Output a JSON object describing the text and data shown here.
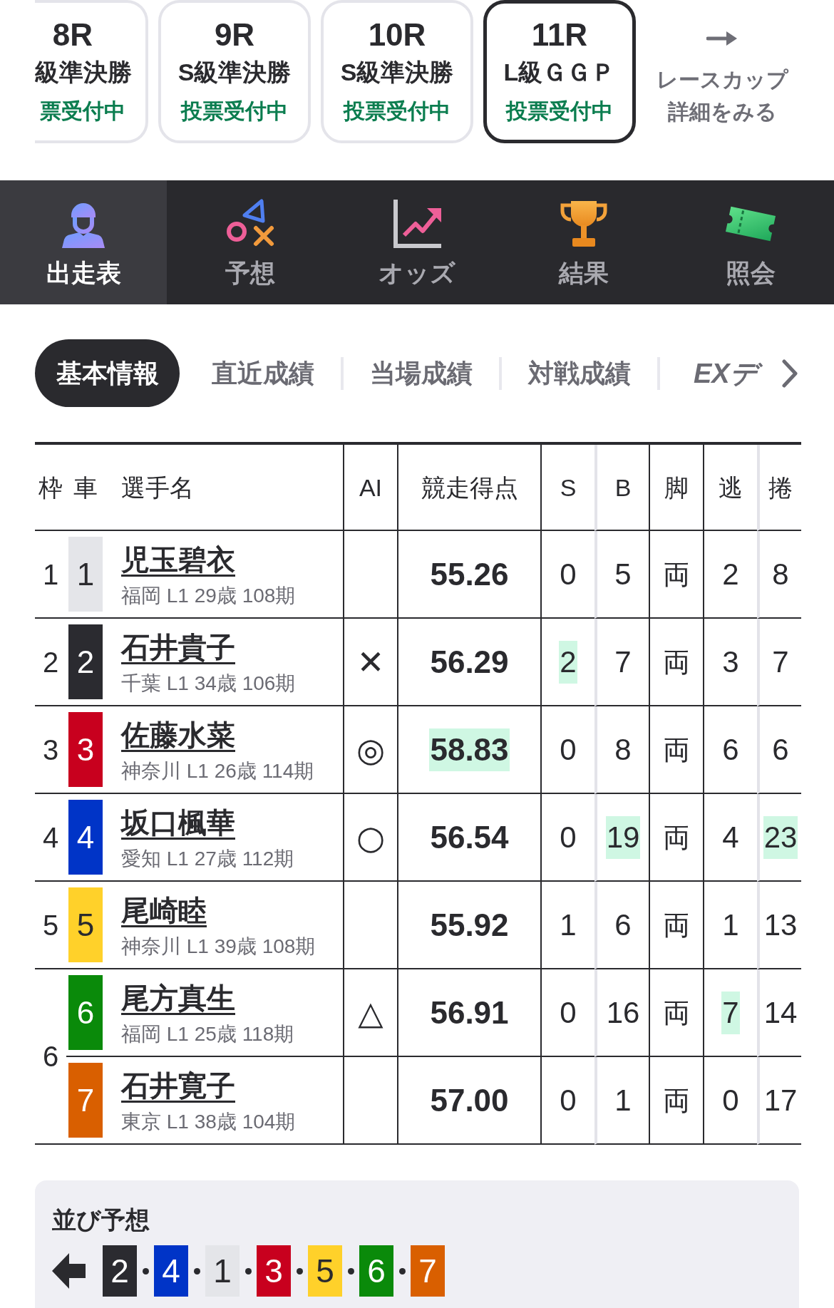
{
  "race_cards": [
    {
      "race": "8R",
      "grade": "級準決勝",
      "status": "票受付中",
      "selected": false,
      "cut_off": true
    },
    {
      "race": "9R",
      "grade": "S級準決勝",
      "status": "投票受付中",
      "selected": false
    },
    {
      "race": "10R",
      "grade": "S級準決勝",
      "status": "投票受付中",
      "selected": false
    },
    {
      "race": "11R",
      "grade": "L級ＧＧＰ",
      "status": "投票受付中",
      "selected": true
    }
  ],
  "cup_link": {
    "lines": [
      "レースカップ",
      "詳細をみる"
    ]
  },
  "nav_tabs": [
    {
      "label": "出走表",
      "kind": "entries",
      "selected": true
    },
    {
      "label": "予想",
      "kind": "prediction",
      "selected": false
    },
    {
      "label": "オッズ",
      "kind": "odds",
      "selected": false
    },
    {
      "label": "結果",
      "kind": "results",
      "selected": false
    },
    {
      "label": "照会",
      "kind": "inquiry",
      "selected": false
    }
  ],
  "sub_tabs": [
    {
      "label": "基本情報",
      "kind": "text",
      "selected": true
    },
    {
      "label": "直近成績",
      "kind": "text",
      "selected": false
    },
    {
      "label": "当場成績",
      "kind": "text",
      "selected": false
    },
    {
      "label": "対戦成績",
      "kind": "text",
      "selected": false
    },
    {
      "label": "EXデ",
      "kind": "logo",
      "selected": false
    }
  ],
  "table": {
    "columns": [
      "枠",
      "車",
      "選手名",
      "AI",
      "競走得点",
      "S",
      "B",
      "脚",
      "逃",
      "捲"
    ],
    "frames": [
      {
        "frame": "1",
        "entries": [
          {
            "car": "1",
            "color": "#e4e5e9",
            "name": "児玉碧衣",
            "profile": "福岡 L1 29歳 108期",
            "stats": [
              {
                "value": "55.26",
                "highlighted": false
              },
              {
                "value": "0",
                "highlighted": false
              },
              {
                "value": "5",
                "highlighted": false
              },
              {
                "value": "両",
                "highlighted": false
              },
              {
                "value": "2",
                "highlighted": false
              },
              {
                "value": "8",
                "highlighted": false
              }
            ]
          }
        ]
      },
      {
        "frame": "2",
        "entries": [
          {
            "car": "2",
            "color": "#2b2b30",
            "name": "石井貴子",
            "profile": "千葉 L1 34歳 106期",
            "ai_mark": "✕",
            "stats": [
              {
                "value": "56.29",
                "highlighted": false
              },
              {
                "value": "2",
                "highlighted": true
              },
              {
                "value": "7",
                "highlighted": false
              },
              {
                "value": "両",
                "highlighted": false
              },
              {
                "value": "3",
                "highlighted": false
              },
              {
                "value": "7",
                "highlighted": false
              }
            ]
          }
        ]
      },
      {
        "frame": "3",
        "entries": [
          {
            "car": "3",
            "color": "#c8001e",
            "name": "佐藤水菜",
            "profile": "神奈川 L1 26歳 114期",
            "ai_mark": "◎",
            "stats": [
              {
                "value": "58.83",
                "highlighted": true
              },
              {
                "value": "0",
                "highlighted": false
              },
              {
                "value": "8",
                "highlighted": false
              },
              {
                "value": "両",
                "highlighted": false
              },
              {
                "value": "6",
                "highlighted": false
              },
              {
                "value": "6",
                "highlighted": false
              }
            ]
          }
        ]
      },
      {
        "frame": "4",
        "entries": [
          {
            "car": "4",
            "color": "#0034c7",
            "name": "坂口楓華",
            "profile": "愛知 L1 27歳 112期",
            "ai_mark": "○",
            "stats": [
              {
                "value": "56.54",
                "highlighted": false
              },
              {
                "value": "0",
                "highlighted": false
              },
              {
                "value": "19",
                "highlighted": true
              },
              {
                "value": "両",
                "highlighted": false
              },
              {
                "value": "4",
                "highlighted": false
              },
              {
                "value": "23",
                "highlighted": true
              }
            ]
          }
        ]
      },
      {
        "frame": "5",
        "entries": [
          {
            "car": "5",
            "color": "#ffd12a",
            "name": "尾崎睦",
            "profile": "神奈川 L1 39歳 108期",
            "stats": [
              {
                "value": "55.92",
                "highlighted": false
              },
              {
                "value": "1",
                "highlighted": false
              },
              {
                "value": "6",
                "highlighted": false
              },
              {
                "value": "両",
                "highlighted": false
              },
              {
                "value": "1",
                "highlighted": false
              },
              {
                "value": "13",
                "highlighted": false
              }
            ]
          }
        ]
      },
      {
        "frame": "6",
        "entries": [
          {
            "car": "6",
            "color": "#0a8a0a",
            "name": "尾方真生",
            "profile": "福岡 L1 25歳 118期",
            "ai_mark": "△",
            "stats": [
              {
                "value": "56.91",
                "highlighted": false
              },
              {
                "value": "0",
                "highlighted": false
              },
              {
                "value": "16",
                "highlighted": false
              },
              {
                "value": "両",
                "highlighted": false
              },
              {
                "value": "7",
                "highlighted": true
              },
              {
                "value": "14",
                "highlighted": false
              }
            ]
          },
          {
            "car": "7",
            "color": "#d95f00",
            "name": "石井寛子",
            "profile": "東京 L1 38歳 104期",
            "stats": [
              {
                "value": "57.00",
                "highlighted": false
              },
              {
                "value": "0",
                "highlighted": false
              },
              {
                "value": "1",
                "highlighted": false
              },
              {
                "value": "両",
                "highlighted": false
              },
              {
                "value": "0",
                "highlighted": false
              },
              {
                "value": "17",
                "highlighted": false
              }
            ]
          }
        ]
      }
    ]
  },
  "line_prediction": {
    "title": "並び予想",
    "cars": [
      {
        "number": "2",
        "color": "#2b2b30"
      },
      {
        "number": "4",
        "color": "#0034c7"
      },
      {
        "number": "1",
        "color": "#e4e5e9"
      },
      {
        "number": "3",
        "color": "#c8001e"
      },
      {
        "number": "5",
        "color": "#ffd12a"
      },
      {
        "number": "6",
        "color": "#0a8a0a"
      },
      {
        "number": "7",
        "color": "#d95f00"
      }
    ]
  }
}
